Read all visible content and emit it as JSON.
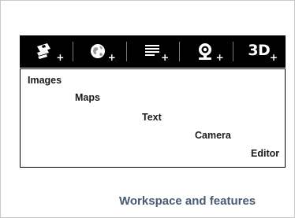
{
  "toolbar": {
    "buttons": [
      {
        "icon": "images-add-icon"
      },
      {
        "icon": "maps-add-icon"
      },
      {
        "icon": "text-add-icon"
      },
      {
        "icon": "camera-add-icon"
      },
      {
        "icon": "3d-add-icon",
        "label": "3D"
      }
    ],
    "plus_glyph": "+"
  },
  "features": {
    "images": "Images",
    "maps": "Maps",
    "text": "Text",
    "camera": "Camera",
    "editor": "Editor"
  },
  "caption": "Workspace and features",
  "colors": {
    "toolbar_bg": "#000000",
    "icon": "#ffffff",
    "caption": "#4a5a72"
  }
}
